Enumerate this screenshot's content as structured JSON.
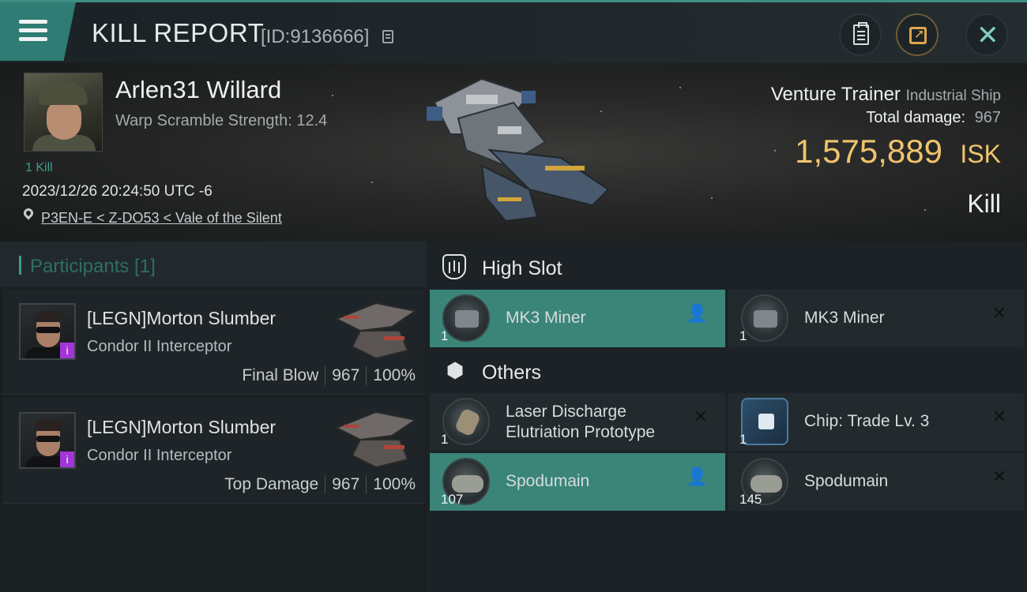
{
  "header": {
    "title": "KILL REPORT",
    "report_id": "[ID:9136666]"
  },
  "victim": {
    "name": "Arlen31 Willard",
    "warp_scramble": "Warp Scramble Strength: 12.4",
    "kills": "1 Kill",
    "datetime": "2023/12/26 20:24:50 UTC -6",
    "location": "P3EN-E < Z-DO53 < Vale of the Silent"
  },
  "ship": {
    "name": "Venture Trainer",
    "class": "Industrial Ship",
    "total_damage_label": "Total damage:",
    "total_damage": "967",
    "isk_value": "1,575,889",
    "isk_unit": "ISK",
    "result": "Kill"
  },
  "participants": {
    "header": "Participants [1]",
    "rows": [
      {
        "name": "[LEGN]Morton Slumber",
        "ship": "Condor II Interceptor",
        "role": "Final Blow",
        "damage": "967",
        "percent": "100%",
        "badge": "i"
      },
      {
        "name": "[LEGN]Morton Slumber",
        "ship": "Condor II Interceptor",
        "role": "Top Damage",
        "damage": "967",
        "percent": "100%",
        "badge": "i"
      }
    ]
  },
  "slots": {
    "high_slot": {
      "label": "High Slot",
      "items": [
        {
          "name": "MK3 Miner",
          "qty": "1",
          "selected": true,
          "action": "pilot-icon"
        },
        {
          "name": "MK3 Miner",
          "qty": "1",
          "selected": false,
          "action": "close-icon"
        }
      ]
    },
    "others": {
      "label": "Others",
      "items": [
        {
          "name": "Laser Discharge Elutriation Prototype",
          "qty": "1",
          "selected": false,
          "action": "close-icon"
        },
        {
          "name": "Chip: Trade Lv. 3",
          "qty": "1",
          "selected": false,
          "action": "close-icon"
        },
        {
          "name": "Spodumain",
          "qty": "107",
          "selected": true,
          "action": "pilot-icon"
        },
        {
          "name": "Spodumain",
          "qty": "145",
          "selected": false,
          "action": "close-icon"
        }
      ]
    }
  },
  "colors": {
    "accent_teal": "#3e9c8f",
    "selected_row": "#3a8578",
    "isk_gold": "#f0c46d",
    "badge_purple": "#a335d8"
  }
}
